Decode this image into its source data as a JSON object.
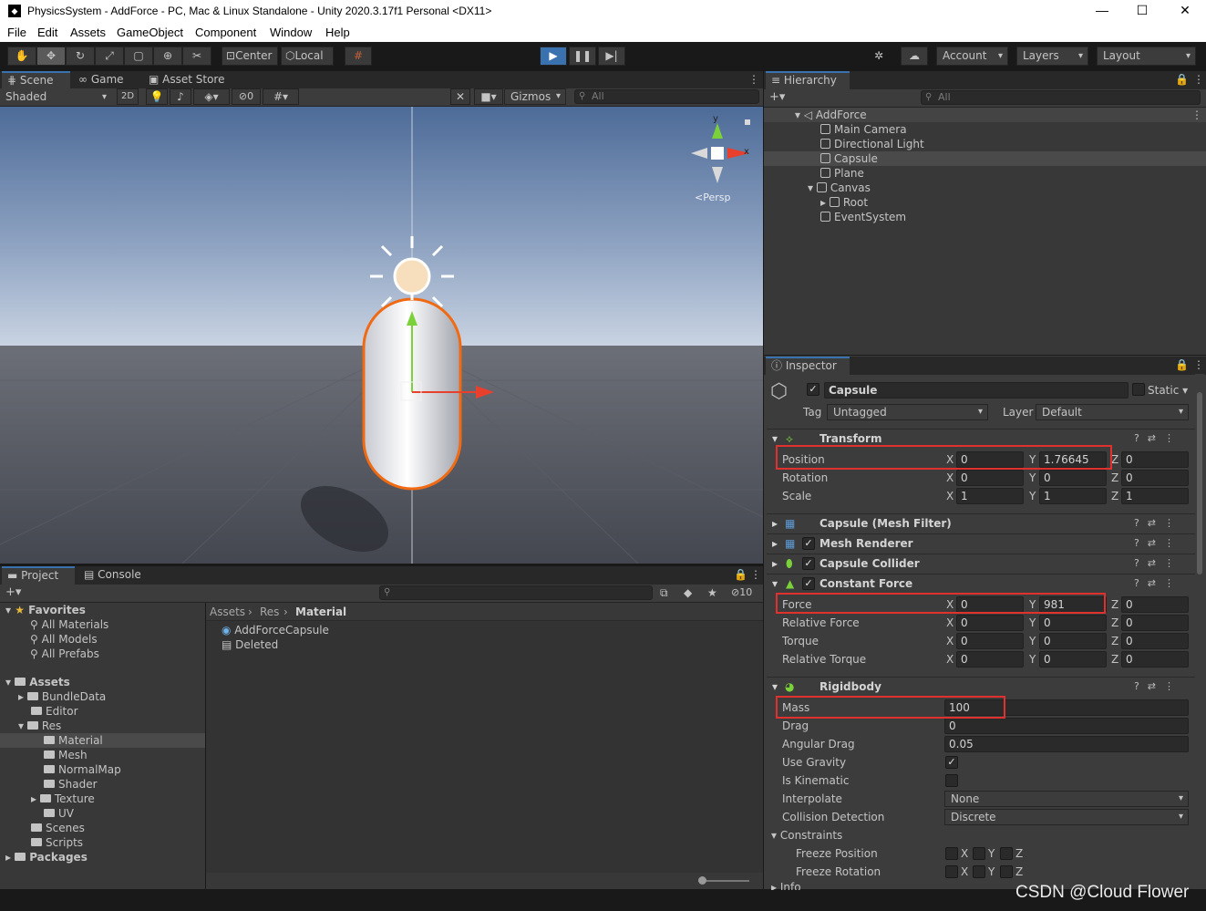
{
  "window": {
    "title": "PhysicsSystem - AddForce - PC, Mac & Linux Standalone - Unity 2020.3.17f1 Personal <DX11>",
    "minimize": "—",
    "maximize": "☐",
    "close": "✕"
  },
  "menu": [
    "File",
    "Edit",
    "Assets",
    "GameObject",
    "Component",
    "Window",
    "Help"
  ],
  "toolbar": {
    "center": "Center",
    "local": "Local",
    "account": "Account",
    "layers": "Layers",
    "layout": "Layout"
  },
  "scene_tabs": {
    "scene": "Scene",
    "game": "Game",
    "asset_store": "Asset Store"
  },
  "scene_bar": {
    "shading": "Shaded",
    "mode2d": "2D",
    "hidden_count": "0",
    "gizmos": "Gizmos",
    "search_placeholder": "All"
  },
  "gizmo": {
    "x": "x",
    "y": "y",
    "persp": "Persp"
  },
  "hierarchy": {
    "tab": "Hierarchy",
    "search_placeholder": "All",
    "scene": "AddForce",
    "items": [
      "Main Camera",
      "Directional Light",
      "Capsule",
      "Plane",
      "Canvas",
      "Root",
      "EventSystem"
    ]
  },
  "inspector": {
    "tab": "Inspector",
    "object_name": "Capsule",
    "static_label": "Static",
    "tag_label": "Tag",
    "tag_value": "Untagged",
    "layer_label": "Layer",
    "layer_value": "Default",
    "transform": {
      "title": "Transform",
      "rows": [
        {
          "label": "Position",
          "x": "0",
          "y": "1.76645",
          "z": "0"
        },
        {
          "label": "Rotation",
          "x": "0",
          "y": "0",
          "z": "0"
        },
        {
          "label": "Scale",
          "x": "1",
          "y": "1",
          "z": "1"
        }
      ]
    },
    "mesh_filter": "Capsule (Mesh Filter)",
    "mesh_renderer": "Mesh Renderer",
    "capsule_collider": "Capsule Collider",
    "constant_force": {
      "title": "Constant Force",
      "rows": [
        {
          "label": "Force",
          "x": "0",
          "y": "981",
          "z": "0"
        },
        {
          "label": "Relative Force",
          "x": "0",
          "y": "0",
          "z": "0"
        },
        {
          "label": "Torque",
          "x": "0",
          "y": "0",
          "z": "0"
        },
        {
          "label": "Relative Torque",
          "x": "0",
          "y": "0",
          "z": "0"
        }
      ]
    },
    "rigidbody": {
      "title": "Rigidbody",
      "mass_label": "Mass",
      "mass": "100",
      "drag_label": "Drag",
      "drag": "0",
      "angular_drag_label": "Angular Drag",
      "angular_drag": "0.05",
      "use_gravity_label": "Use Gravity",
      "use_gravity": true,
      "is_kinematic_label": "Is Kinematic",
      "is_kinematic": false,
      "interpolate_label": "Interpolate",
      "interpolate": "None",
      "collision_label": "Collision Detection",
      "collision": "Discrete",
      "constraints_label": "Constraints",
      "freeze_position_label": "Freeze Position",
      "freeze_rotation_label": "Freeze Rotation",
      "axis_x": "X",
      "axis_y": "Y",
      "axis_z": "Z",
      "info_label": "Info"
    },
    "axis_labels": {
      "x": "X",
      "y": "Y",
      "z": "Z"
    }
  },
  "project": {
    "tab_project": "Project",
    "tab_console": "Console",
    "hidden_count": "10",
    "breadcrumb": [
      "Assets",
      "Res",
      "Material"
    ],
    "favorites_label": "Favorites",
    "favorites": [
      "All Materials",
      "All Models",
      "All Prefabs"
    ],
    "assets_label": "Assets",
    "tree": [
      "BundleData",
      "Editor",
      "Res",
      "Material",
      "Mesh",
      "NormalMap",
      "Shader",
      "Texture",
      "UV",
      "Scenes",
      "Scripts"
    ],
    "packages_label": "Packages",
    "files": [
      "AddForceCapsule",
      "Deleted"
    ]
  },
  "watermark": "CSDN @Cloud Flower",
  "colors": {
    "accent": "#3a72b0",
    "highlight_box": "#e0312f",
    "selection": "#2c5d87",
    "capsule_outline": "#f06a14"
  }
}
